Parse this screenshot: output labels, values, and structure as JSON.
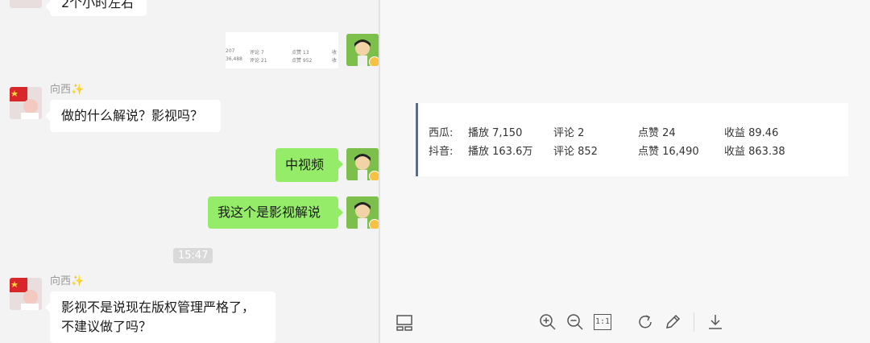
{
  "chat": {
    "top_bubble_text": "2个小时左右",
    "screenshot_thumb": {
      "row1": [
        "207",
        "评论 7",
        "点赞 13",
        "收"
      ],
      "row2": [
        "36,488",
        "评论 21",
        "点赞 952",
        "收"
      ]
    },
    "messages": [
      {
        "sender": "向西✨",
        "text": "做的什么解说？影视吗？"
      },
      {
        "sender": "me",
        "text": "中视频"
      },
      {
        "sender": "me",
        "text": "我这个是影视解说"
      },
      {
        "sender": "向西✨",
        "text": "影视不是说现在版权管理严格了，不建议做了吗？"
      }
    ],
    "timestamp": "15:47"
  },
  "viewer": {
    "stats": {
      "rows": [
        {
          "platform": "西瓜:",
          "play": "播放 7,150",
          "comment": "评论 2",
          "like": "点赞 24",
          "income": "收益 89.46"
        },
        {
          "platform": "抖音:",
          "play": "播放 163.6万",
          "comment": "评论 852",
          "like": "点赞 16,490",
          "income": "收益 863.38"
        }
      ]
    },
    "toolbar": {
      "actual_size_label": "1:1",
      "icons": [
        "thumbnail-icon",
        "zoom-in-icon",
        "zoom-out-icon",
        "actual-size-icon",
        "rotate-icon",
        "edit-icon",
        "download-icon"
      ]
    }
  },
  "colors": {
    "green_bubble": "#95ec69",
    "card_accent": "#5c6b85"
  }
}
